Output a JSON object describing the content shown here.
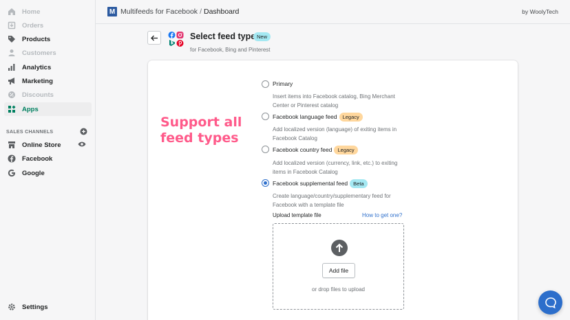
{
  "sidebar": {
    "items": [
      {
        "label": "Home",
        "icon": "home-icon",
        "state": "disabled"
      },
      {
        "label": "Orders",
        "icon": "orders-icon",
        "state": "disabled"
      },
      {
        "label": "Products",
        "icon": "tag-icon",
        "state": "normal"
      },
      {
        "label": "Customers",
        "icon": "person-icon",
        "state": "disabled"
      },
      {
        "label": "Analytics",
        "icon": "bar-chart-icon",
        "state": "normal"
      },
      {
        "label": "Marketing",
        "icon": "megaphone-icon",
        "state": "normal"
      },
      {
        "label": "Discounts",
        "icon": "discount-icon",
        "state": "disabled"
      },
      {
        "label": "Apps",
        "icon": "apps-icon",
        "state": "active"
      }
    ],
    "sales_channels_heading": "SALES CHANNELS",
    "channels": [
      {
        "label": "Online Store",
        "icon": "store-icon"
      },
      {
        "label": "Facebook",
        "icon": "facebook-icon"
      },
      {
        "label": "Google",
        "icon": "google-icon"
      }
    ],
    "settings_label": "Settings"
  },
  "topbar": {
    "logo_letter": "M",
    "app_name": "Multifeeds for Facebook",
    "separator": "/",
    "page": "Dashboard",
    "company": "by WoolyTech"
  },
  "header": {
    "title": "Select feed type",
    "title_badge": "New",
    "subtitle": "for Facebook, Bing and Pinterest"
  },
  "promo_text_line1": "Support all",
  "promo_text_line2": "feed types",
  "options": [
    {
      "label": "Primary",
      "badge": "",
      "description": "Insert items into Facebook catalog, Bing Merchant Center or Pinterest catalog",
      "checked": false
    },
    {
      "label": "Facebook language feed",
      "badge": "Legacy",
      "description": "Add localized version (language) of exiting items in Facebook Catalog",
      "checked": false
    },
    {
      "label": "Facebook country feed",
      "badge": "Legacy",
      "description": "Add localized version (currency, link, etc.) to exiting items in Facebook Catalog",
      "checked": false
    },
    {
      "label": "Facebook supplemental feed",
      "badge": "Beta",
      "description": "Create language/country/supplementary feed for Facebook with a template file",
      "checked": true
    }
  ],
  "upload": {
    "label": "Upload template file",
    "help_link": "How to get one?",
    "button": "Add file",
    "hint": "or drop files to upload"
  },
  "colors": {
    "accent": "#2c6ecb",
    "active_green": "#008060",
    "promo_pink": "#ff5a8a"
  }
}
